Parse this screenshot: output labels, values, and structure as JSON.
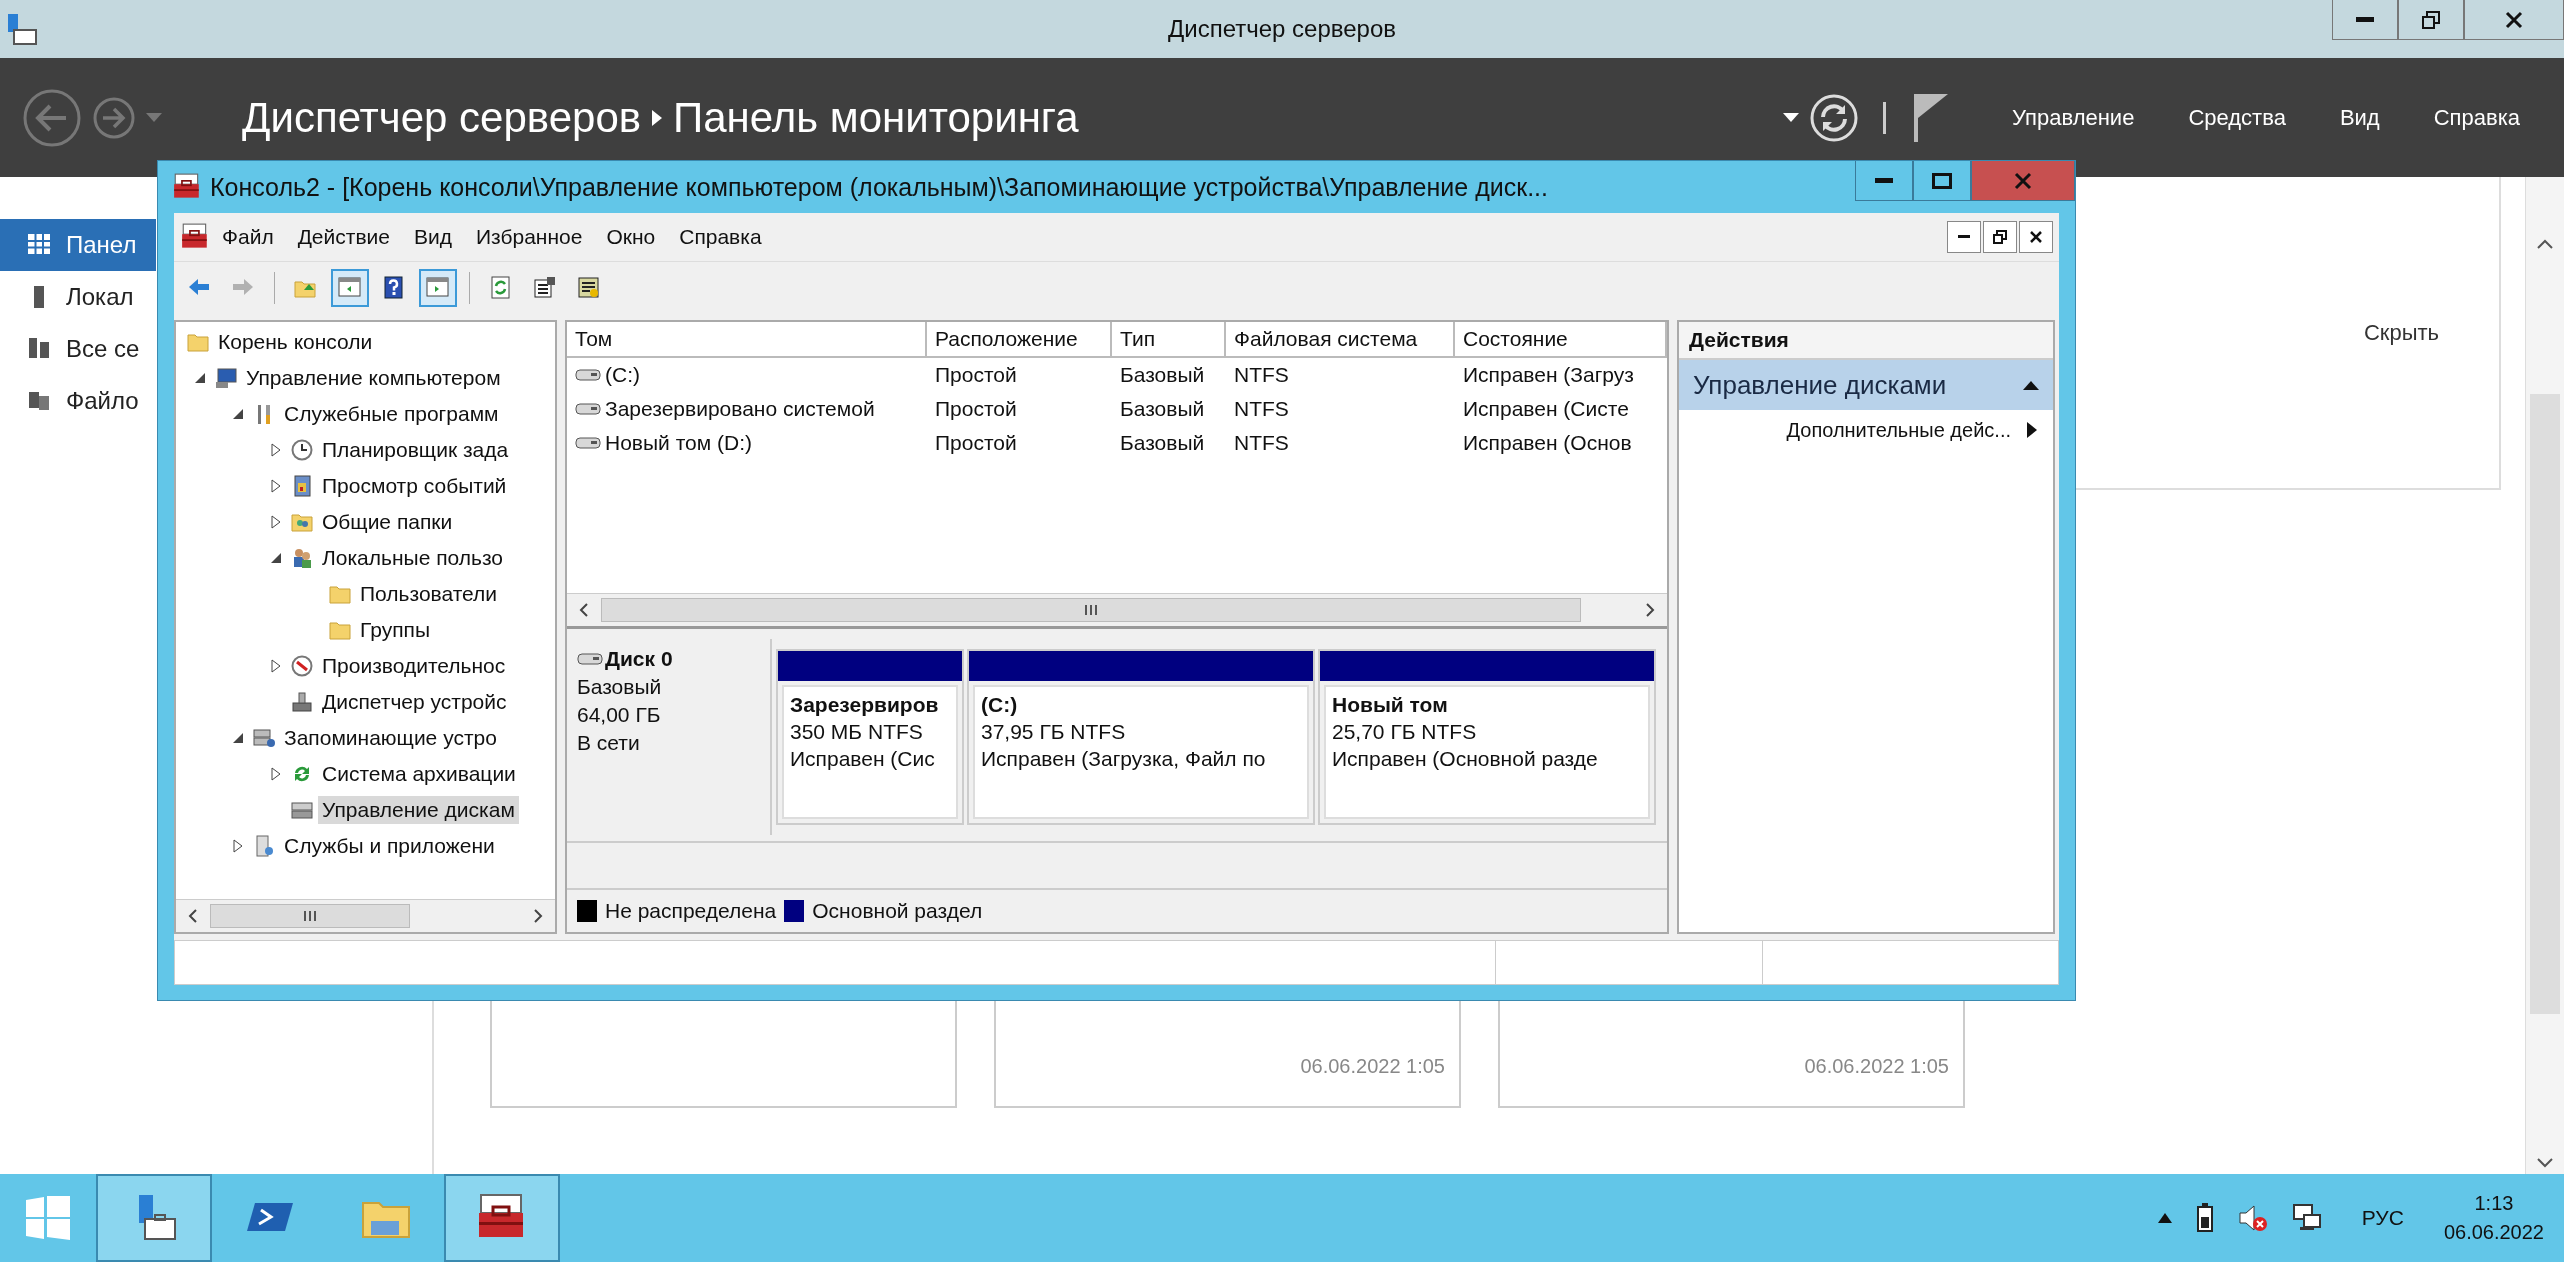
{
  "server_manager": {
    "title": "Диспетчер серверов",
    "breadcrumb": [
      "Диспетчер серверов",
      "Панель мониторинга"
    ],
    "menus": [
      "Управление",
      "Средства",
      "Вид",
      "Справка"
    ],
    "nav": [
      {
        "label": "Панел",
        "selected": true
      },
      {
        "label": "Локал",
        "selected": false
      },
      {
        "label": "Все се",
        "selected": false
      },
      {
        "label": "Файло",
        "selected": false
      }
    ],
    "hide_link": "Скрыть",
    "tile_timestamps": [
      "06.06.2022 1:05",
      "06.06.2022 1:05"
    ]
  },
  "console": {
    "title": "Консоль2 - [Корень консоли\\Управление компьютером (локальным)\\Запоминающие устройства\\Управление диск...",
    "menu": [
      "Файл",
      "Действие",
      "Вид",
      "Избранное",
      "Окно",
      "Справка"
    ],
    "toolbar": [
      {
        "pressed": false,
        "disabled": false
      },
      {
        "pressed": false,
        "disabled": true
      },
      {
        "pressed": false,
        "disabled": false
      },
      {
        "pressed": true,
        "disabled": false
      },
      {
        "pressed": false,
        "disabled": false
      },
      {
        "pressed": true,
        "disabled": false
      },
      {
        "pressed": false,
        "disabled": false
      },
      {
        "pressed": false,
        "disabled": false
      },
      {
        "pressed": false,
        "disabled": false
      }
    ],
    "tree": [
      {
        "label": "Корень консоли",
        "selected": false,
        "children": [
          {
            "label": "Управление компьютером",
            "selected": false,
            "expanded": true,
            "children": [
              {
                "label": "Служебные программ",
                "selected": false,
                "expanded": true,
                "children": [
                  {
                    "label": "Планировщик зада",
                    "selected": false,
                    "expanded": false
                  },
                  {
                    "label": "Просмотр событий",
                    "selected": false,
                    "expanded": false
                  },
                  {
                    "label": "Общие папки",
                    "selected": false,
                    "expanded": false
                  },
                  {
                    "label": "Локальные пользо",
                    "selected": false,
                    "expanded": true,
                    "children": [
                      {
                        "label": "Пользователи",
                        "selected": false
                      },
                      {
                        "label": "Группы",
                        "selected": false
                      }
                    ]
                  },
                  {
                    "label": "Производительнос",
                    "selected": false,
                    "expanded": false
                  },
                  {
                    "label": "Диспетчер устройс",
                    "selected": false
                  }
                ]
              },
              {
                "label": "Запоминающие устро",
                "selected": false,
                "expanded": true,
                "children": [
                  {
                    "label": "Система архивации",
                    "selected": false,
                    "expanded": false
                  },
                  {
                    "label": "Управление дискам",
                    "selected": true
                  }
                ]
              },
              {
                "label": "Службы и приложени",
                "selected": false,
                "expanded": false
              }
            ]
          }
        ]
      }
    ],
    "volumes": {
      "columns": [
        "Том",
        "Расположение",
        "Тип",
        "Файловая система",
        "Состояние"
      ],
      "rows": [
        [
          "(C:)",
          "Простой",
          "Базовый",
          "NTFS",
          "Исправен (Загруз"
        ],
        [
          "Зарезервировано системой",
          "Простой",
          "Базовый",
          "NTFS",
          "Исправен (Систе"
        ],
        [
          "Новый том (D:)",
          "Простой",
          "Базовый",
          "NTFS",
          "Исправен (Основ"
        ]
      ]
    },
    "disks": [
      {
        "name": "Диск 0",
        "type": "Базовый",
        "size": "64,00 ГБ",
        "status": "В сети",
        "partitions": [
          {
            "name": "Зарезервиров",
            "size": "350 МБ NTFS",
            "status": "Исправен (Сис",
            "color": "#000080"
          },
          {
            "name": "(C:)",
            "size": "37,95 ГБ NTFS",
            "status": "Исправен (Загрузка, Файл по",
            "color": "#000080"
          },
          {
            "name": "Новый том",
            "size": "25,70 ГБ NTFS",
            "status": "Исправен (Основной разде",
            "color": "#000080"
          }
        ]
      }
    ],
    "legend": [
      {
        "label": "Не распределена",
        "color": "#000000"
      },
      {
        "label": "Основной раздел",
        "color": "#000080"
      }
    ],
    "actions": {
      "title": "Действия",
      "sections": [
        {
          "title": "Управление дисками",
          "expanded": true,
          "items": [
            "Дополнительные дейс..."
          ]
        }
      ]
    }
  },
  "taskbar": {
    "apps": [
      {
        "running": true
      },
      {
        "running": false
      },
      {
        "running": false
      },
      {
        "running": true
      }
    ],
    "language": "РУС",
    "time": "1:13",
    "date": "06.06.2022"
  }
}
